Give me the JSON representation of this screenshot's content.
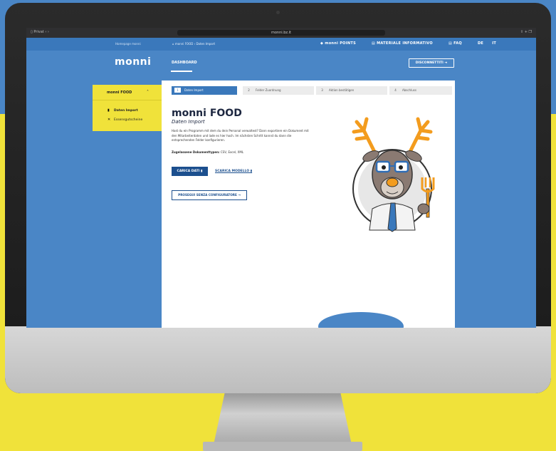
{
  "browser": {
    "window_label": "Privat",
    "url": "monni.bz.it"
  },
  "topnav": {
    "homepage": "Homepage monni",
    "breadcrumb": "monni FOOD › Daten Import",
    "points": "monni POINTS",
    "materiale": "MATERIALE INFORMATIVO",
    "faq": "FAQ",
    "lang_de": "DE",
    "lang_it": "IT"
  },
  "header": {
    "logo": "monni",
    "dashboard": "DASHBOARD",
    "disconnect": "DISCONNETTITI"
  },
  "sidebar": {
    "title": "monni FOOD",
    "items": [
      {
        "label": "Daten Import",
        "icon": "file-icon",
        "active": true
      },
      {
        "label": "Essensgutscheine",
        "icon": "cutlery-icon",
        "active": false
      }
    ]
  },
  "steps": [
    {
      "num": "1",
      "label": "Daten Import",
      "active": true
    },
    {
      "num": "2",
      "label": "Felder Zuordnung",
      "active": false
    },
    {
      "num": "3",
      "label": "Aktion bestätigen",
      "active": false
    },
    {
      "num": "4",
      "label": "Abschluss",
      "active": false
    }
  ],
  "content": {
    "title_a": "monni",
    "title_b": "FOOD",
    "subtitle": "Daten Import",
    "paragraph": "Hast du ein Programm mit dem du dein Personal verwaltest? Dann exportiere ein Dokument mit den Mitarbeiterdaten und lade es hier hoch. Im nächsten Schritt kannst du dann die entsprechenden Felder konfigurieren.",
    "formats_label": "Zugelassene Dokumenttypen:",
    "formats_value": "CSV, Excel, XML",
    "btn_carica": "CARICA DATI",
    "link_scarica": "SCARICA MODELLO",
    "btn_prosegui": "PROSEGUI SENZA CONFIGURATORE →"
  },
  "colors": {
    "brand_blue": "#4a86c6",
    "dark_blue": "#1c4f8e",
    "yellow": "#f0e23a"
  }
}
